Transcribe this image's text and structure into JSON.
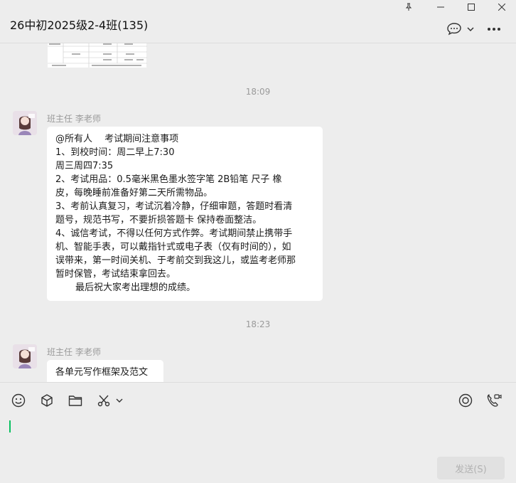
{
  "window": {
    "title": "26中初2025级2-4班(135)",
    "buttons": [
      "pin",
      "minimize",
      "maximize",
      "close"
    ]
  },
  "header": {
    "icons": [
      "chat-bubble-icon",
      "chevron-down-icon",
      "more-icon"
    ]
  },
  "messages": [
    {
      "type": "image",
      "description_visible": "document-thumbnail"
    },
    {
      "type": "timestamp",
      "text": "18:09"
    },
    {
      "type": "text",
      "sender": "班主任 李老师",
      "lines": [
        "@所有人　 考试期间注意事项",
        "1、到校时间：周二早上7:30",
        "周三周四7:35",
        "2、考试用品：0.5毫米黑色墨水签字笔 2B铅笔 尺子 橡",
        "皮，每晚睡前准备好第二天所需物品。",
        "3、考前认真复习，考试沉着冷静，仔细审题，答题时看清",
        "题号，规范书写，不要折损答题卡 保持卷面整洁。",
        "4、诚信考试，不得以任何方式作弊。考试期间禁止携带手",
        "机、智能手表，可以戴指针式或电子表（仅有时间的），如",
        "误带来，第一时间关机、于考前交到我这儿，或监考老师那",
        "暂时保管，考试结束拿回去。",
        "最后祝大家考出理想的成绩。"
      ]
    },
    {
      "type": "timestamp",
      "text": "18:23"
    },
    {
      "type": "text",
      "sender": "班主任 李老师",
      "lines": [
        "各单元写作框架及范文"
      ]
    }
  ],
  "toolbar": {
    "icons": [
      "emoji-icon",
      "box-icon",
      "folder-icon",
      "scissors-icon",
      "chevron-down-icon",
      "live-icon",
      "phone-video-icon"
    ]
  },
  "composer": {
    "value": "",
    "send_label": "发送(S)"
  },
  "colors": {
    "background": "#ededed",
    "bubble": "#ffffff",
    "caret": "#07c160"
  }
}
